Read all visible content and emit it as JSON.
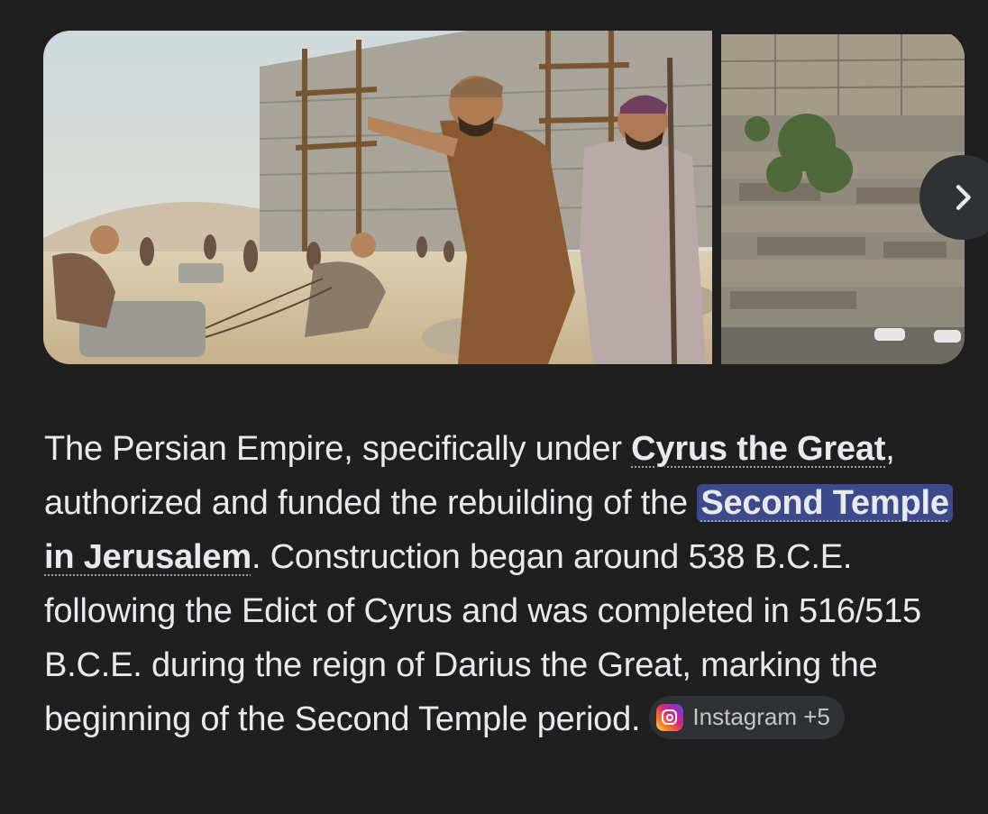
{
  "images": [
    {
      "name": "Temple rebuilding illustration"
    },
    {
      "name": "Jerusalem temple ruins photo"
    }
  ],
  "carousel": {
    "next_icon": "chevron-right-icon"
  },
  "answer": {
    "intro": "The Persian Empire, specifically under ",
    "entity1": "Cyrus the Great",
    "text2": ", authorized and funded the rebuilding of the ",
    "entity2_highlight": "Second Temple",
    "entity2_rest": " in Jerusalem",
    "text3": ". Construction began around 538 B.C.E. following the Edict of Cyrus and was completed in 516/515 B.C.E. during the reign of Darius the Great, marking the beginning of the Second Temple period."
  },
  "source_chip": {
    "icon": "instagram-icon",
    "label": "Instagram +5"
  },
  "colors": {
    "background": "#1f1f1f",
    "text": "#e8eaed",
    "highlight": "#3c4a8c",
    "chip": "#303134"
  }
}
